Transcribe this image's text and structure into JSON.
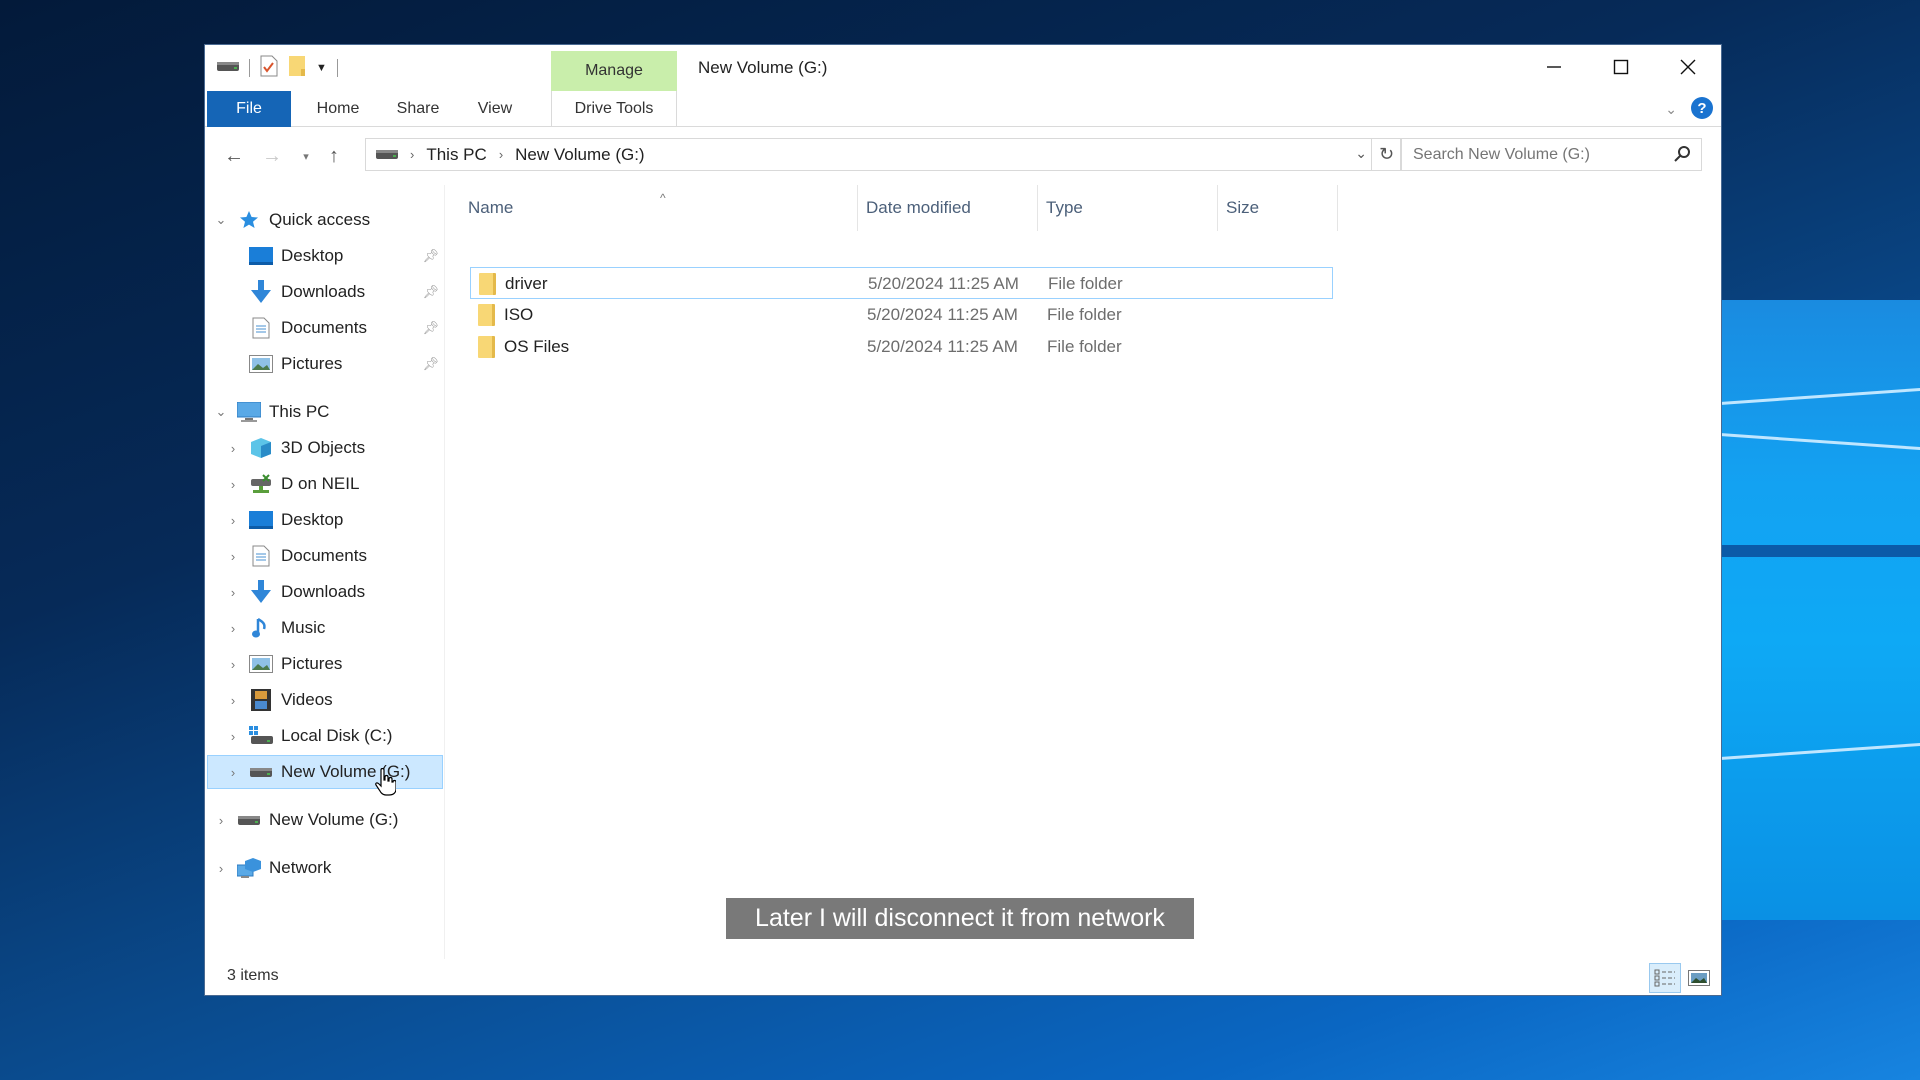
{
  "window": {
    "title": "New Volume (G:)",
    "contextual_tab_group": "Manage"
  },
  "ribbon": {
    "tabs": [
      "File",
      "Home",
      "Share",
      "View",
      "Drive Tools"
    ],
    "active_tab": "File",
    "colors": {
      "file_tab": "#1565b6",
      "manage_group": "#c9eeab"
    }
  },
  "navigation": {
    "address_path": [
      "This PC",
      "New Volume (G:)"
    ],
    "search_placeholder": "Search New Volume (G:)"
  },
  "nav_pane": {
    "quick_access": {
      "label": "Quick access",
      "items": [
        {
          "label": "Desktop",
          "icon": "desktop-icon",
          "pinned": true
        },
        {
          "label": "Downloads",
          "icon": "downloads-icon",
          "pinned": true
        },
        {
          "label": "Documents",
          "icon": "documents-icon",
          "pinned": true
        },
        {
          "label": "Pictures",
          "icon": "pictures-icon",
          "pinned": true
        }
      ]
    },
    "this_pc": {
      "label": "This PC",
      "items": [
        {
          "label": "3D Objects",
          "icon": "3d-objects-icon"
        },
        {
          "label": "D on NEIL",
          "icon": "network-drive-icon"
        },
        {
          "label": "Desktop",
          "icon": "desktop-icon"
        },
        {
          "label": "Documents",
          "icon": "documents-icon"
        },
        {
          "label": "Downloads",
          "icon": "downloads-icon"
        },
        {
          "label": "Music",
          "icon": "music-icon"
        },
        {
          "label": "Pictures",
          "icon": "pictures-icon"
        },
        {
          "label": "Videos",
          "icon": "videos-icon"
        },
        {
          "label": "Local Disk (C:)",
          "icon": "local-disk-icon"
        },
        {
          "label": "New Volume (G:)",
          "icon": "drive-icon",
          "selected": true
        }
      ]
    },
    "root_items": [
      {
        "label": "New Volume (G:)",
        "icon": "drive-icon"
      },
      {
        "label": "Network",
        "icon": "network-icon"
      }
    ]
  },
  "file_list": {
    "columns": [
      "Name",
      "Date modified",
      "Type",
      "Size"
    ],
    "rows": [
      {
        "name": "driver",
        "date": "5/20/2024 11:25 AM",
        "type": "File folder",
        "size": ""
      },
      {
        "name": "ISO",
        "date": "5/20/2024 11:25 AM",
        "type": "File folder",
        "size": ""
      },
      {
        "name": "OS Files",
        "date": "5/20/2024 11:25 AM",
        "type": "File folder",
        "size": ""
      }
    ]
  },
  "status": {
    "item_count": "3 items"
  },
  "subtitle": "Later I will disconnect it from network"
}
